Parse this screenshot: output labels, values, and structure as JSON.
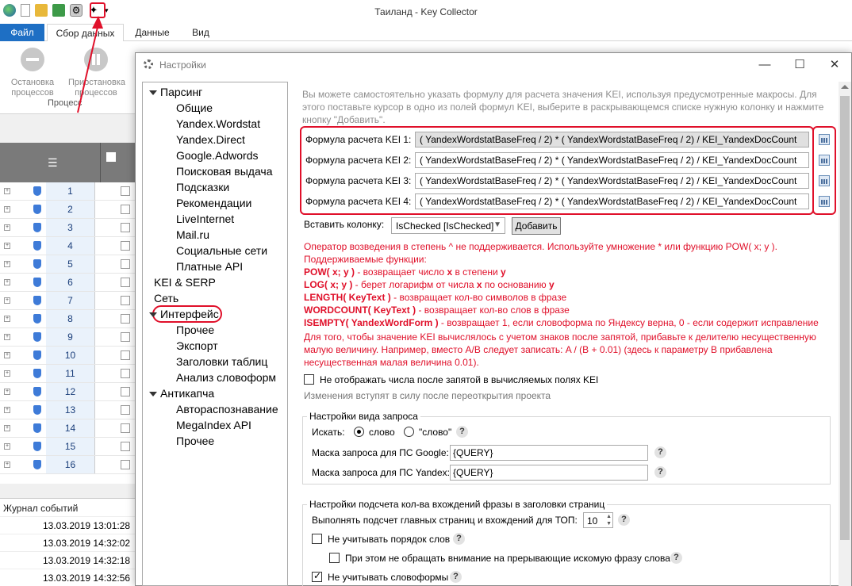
{
  "app": {
    "title": "Таиланд - Key Collector",
    "tabs": [
      "Файл",
      "Сбор данных",
      "Данные",
      "Вид"
    ],
    "ribbon": {
      "stop": "Остановка процессов",
      "pause": "Приостановка процессов",
      "group": "Процесс"
    },
    "rows": [
      "1",
      "2",
      "3",
      "4",
      "5",
      "6",
      "7",
      "8",
      "9",
      "10",
      "11",
      "12",
      "13",
      "14",
      "15",
      "16"
    ],
    "journal": {
      "title": "Журнал событий",
      "entries": [
        "13.03.2019 13:01:28",
        "13.03.2019 14:32:02",
        "13.03.2019 14:32:18",
        "13.03.2019 14:32:56"
      ]
    }
  },
  "dialog": {
    "title": "Настройки",
    "tree": [
      {
        "label": "Парсинг",
        "level": 0,
        "expanded": true
      },
      {
        "label": "Общие",
        "level": 1
      },
      {
        "label": "Yandex.Wordstat",
        "level": 1
      },
      {
        "label": "Yandex.Direct",
        "level": 1
      },
      {
        "label": "Google.Adwords",
        "level": 1
      },
      {
        "label": "Поисковая выдача",
        "level": 1
      },
      {
        "label": "Подсказки",
        "level": 1
      },
      {
        "label": "Рекомендации",
        "level": 1
      },
      {
        "label": "LiveInternet",
        "level": 1
      },
      {
        "label": "Mail.ru",
        "level": 1
      },
      {
        "label": "Социальные сети",
        "level": 1
      },
      {
        "label": "Платные API",
        "level": 1
      },
      {
        "label": "KEI & SERP",
        "level": 0,
        "selected": true
      },
      {
        "label": "Сеть",
        "level": 0
      },
      {
        "label": "Интерфейс",
        "level": 0,
        "expanded": true
      },
      {
        "label": "Прочее",
        "level": 1
      },
      {
        "label": "Экспорт",
        "level": 1
      },
      {
        "label": "Заголовки таблиц",
        "level": 1
      },
      {
        "label": "Анализ словоформ",
        "level": 1
      },
      {
        "label": "Антикапча",
        "level": 0,
        "expanded": true
      },
      {
        "label": "Автораспознавание",
        "level": 1
      },
      {
        "label": "MegaIndex API",
        "level": 1
      },
      {
        "label": "Прочее",
        "level": 1
      }
    ],
    "intro": "Вы можете самостоятельно указать формулу для расчета значения KEI, используя предусмотренные макросы. Для этого поставьте курсор в одно из полей формул KEI, выберите в раскрывающемся списке нужную колонку и нажмите кнопку \"Добавить\".",
    "formulas": [
      {
        "label": "Формула расчета KEI 1:",
        "value": "( YandexWordstatBaseFreq  / 2) * ( YandexWordstatBaseFreq  / 2) / KEI_YandexDocCount"
      },
      {
        "label": "Формула расчета KEI 2:",
        "value": "( YandexWordstatBaseFreq  / 2) * ( YandexWordstatBaseFreq  / 2) / KEI_YandexDocCount"
      },
      {
        "label": "Формула расчета KEI 3:",
        "value": "( YandexWordstatBaseFreq  / 2) * ( YandexWordstatBaseFreq  / 2) / KEI_YandexDocCount"
      },
      {
        "label": "Формула расчета KEI 4:",
        "value": "( YandexWordstatBaseFreq  / 2) * ( YandexWordstatBaseFreq  / 2) / KEI_YandexDocCount"
      }
    ],
    "insert_label": "Вставить колонку:",
    "insert_value": "IsChecked [IsChecked]",
    "add_button": "Добавить",
    "warn1": "Оператор возведения в степень ^ не поддерживается. Используйте умножение * или функцию POW( x; y ).",
    "warn2": "Поддерживаемые функции:",
    "functions": [
      {
        "name": "POW( x; y )",
        "desc": " - возвращает число ",
        "b1": "x",
        "mid": " в степени ",
        "b2": "y"
      },
      {
        "name": "LOG( x; y )",
        "desc": " - берет логарифм от числа ",
        "b1": "x",
        "mid": " по основанию ",
        "b2": "y"
      },
      {
        "name": "LENGTH( KeyText )",
        "desc": " - возвращает кол-во символов в фразе",
        "b1": "",
        "mid": "",
        "b2": ""
      },
      {
        "name": "WORDCOUNT( KeyText )",
        "desc": " - возвращает кол-во слов в фразе",
        "b1": "",
        "mid": "",
        "b2": ""
      },
      {
        "name": "ISEMPTY( YandexWordForm )",
        "desc": " - возвращает 1, если словоформа по Яндексу верна, 0 - если содержит исправление",
        "b1": "",
        "mid": "",
        "b2": ""
      }
    ],
    "warn3": "Для того, чтобы значение KEI вычислялось с учетом знаков после запятой, прибавьте к делителю несущественную малую величину. Например, вместо A/B следует записать: A / (B + 0.01) (здесь к параметру B прибавлена несущественная малая величина 0.01).",
    "no_decimals": "Не отображать числа после запятой в вычисляемых полях KEI",
    "changes_note": "Изменения вступят в силу после переоткрытия проекта",
    "query_group": {
      "title": "Настройки вида запроса",
      "search_label": "Искать:",
      "opt1": "слово",
      "opt2": "\"слово\"",
      "google_label": "Маска запроса для ПС Google:",
      "google_value": "{QUERY}",
      "yandex_label": "Маска запроса для ПС Yandex:",
      "yandex_value": "{QUERY}"
    },
    "count_group": {
      "title": "Настройки подсчета кол-ва вхождений фразы в заголовки страниц",
      "top_label": "Выполнять подсчет главных страниц и вхождений для ТОП:",
      "top_value": "10",
      "order_label": "Не учитывать порядок слов",
      "break_label": "При этом не обращать внимание на прерывающие искомую фразу слова",
      "forms_label": "Не учитывать словоформы"
    }
  }
}
